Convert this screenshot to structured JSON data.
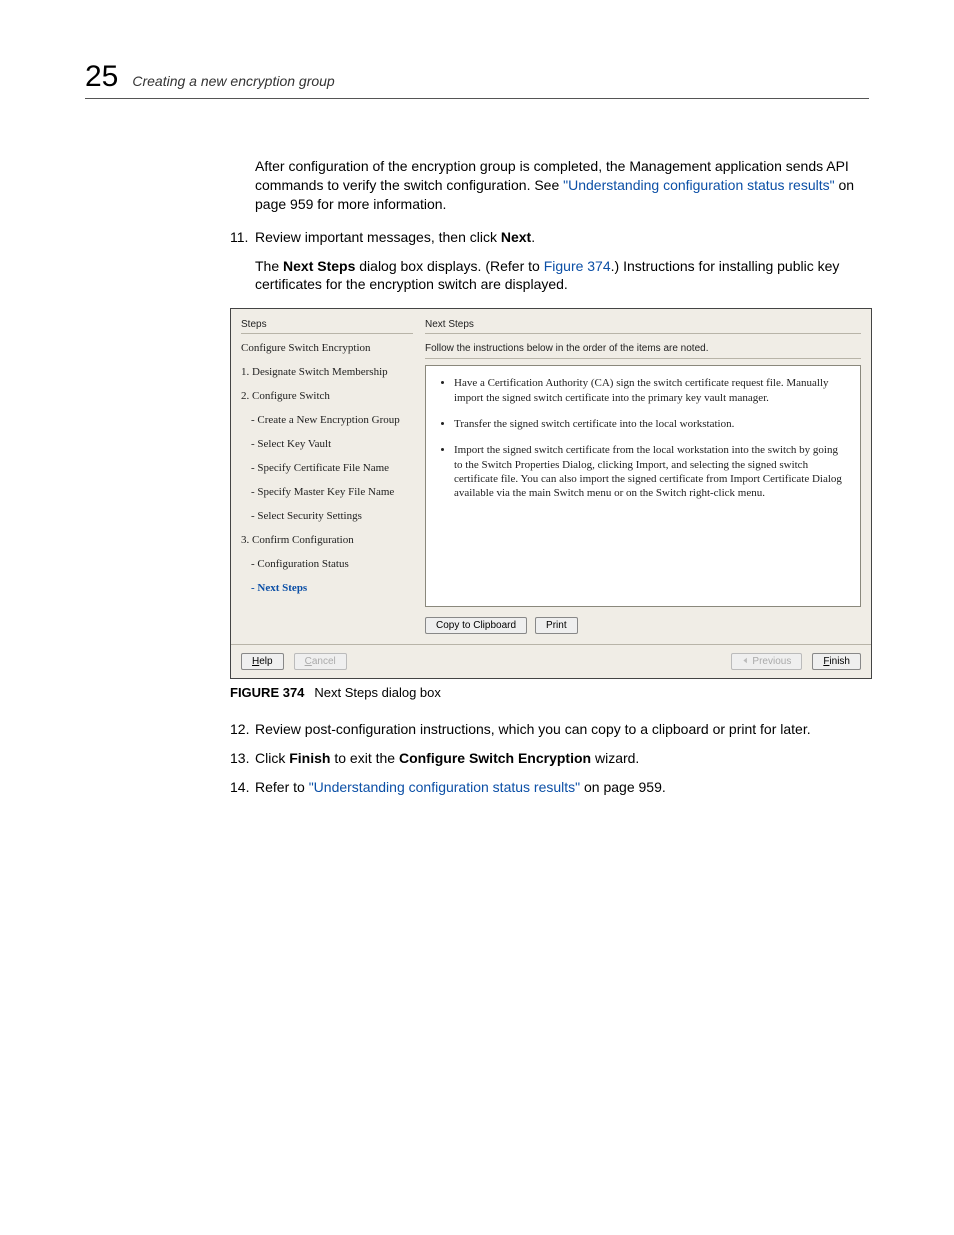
{
  "header": {
    "chapter_number": "25",
    "chapter_title": "Creating a new encryption group"
  },
  "intro": {
    "text_before_link": "After configuration of the encryption group is completed, the Management application sends API commands to verify the switch configuration. See ",
    "link_text": "\"Understanding configuration status results\"",
    "text_after_link": " on page 959 for more information."
  },
  "step11": {
    "num": "11.",
    "before_bold": "Review important messages, then click ",
    "bold": "Next",
    "after_bold": "."
  },
  "step11_sub": {
    "t1": "The ",
    "b1": "Next Steps",
    "t2": " dialog box displays. (Refer to ",
    "link": "Figure 374",
    "t3": ".) Instructions for installing public key certificates for the encryption switch are displayed."
  },
  "dialog": {
    "steps_heading": "Steps",
    "right_heading": "Next Steps",
    "instruction_head": "Follow the instructions below in the order of the items are noted.",
    "steps": {
      "cfg_title": "Configure Switch Encryption",
      "s1": "1. Designate Switch Membership",
      "s2": "2. Configure Switch",
      "s2a": "- Create a New Encryption Group",
      "s2b": "- Select Key Vault",
      "s2c": "- Specify Certificate File Name",
      "s2d": "- Specify Master Key File Name",
      "s2e": "- Select Security Settings",
      "s3": "3. Confirm Configuration",
      "s3a": "- Configuration Status",
      "s3b": "- Next Steps"
    },
    "bullets": {
      "b1": "Have a Certification Authority (CA) sign the switch certificate request file. Manually import the signed switch certificate into the primary key vault manager.",
      "b2": "Transfer the signed switch certificate into the local workstation.",
      "b3": "Import the signed switch certificate from the local workstation into the switch by going to the Switch Properties Dialog, clicking Import, and selecting the signed switch certificate file. You can also import the signed certificate from Import Certificate Dialog available via the main Switch menu or on the Switch right-click menu."
    },
    "buttons": {
      "copy": "Copy to Clipboard",
      "print": "Print",
      "help": "Help",
      "cancel": "Cancel",
      "previous": "Previous",
      "finish": "Finish"
    }
  },
  "figure": {
    "label": "FIGURE 374",
    "caption": "Next Steps dialog box"
  },
  "step12": {
    "num": "12.",
    "text": "Review post-configuration instructions, which you can copy to a clipboard or print for later."
  },
  "step13": {
    "num": "13.",
    "t1": "Click ",
    "b1": "Finish",
    "t2": " to exit the ",
    "b2": "Configure Switch Encryption",
    "t3": " wizard."
  },
  "step14": {
    "num": "14.",
    "t1": "Refer to ",
    "link": "\"Understanding configuration status results\"",
    "t2": " on page 959."
  }
}
